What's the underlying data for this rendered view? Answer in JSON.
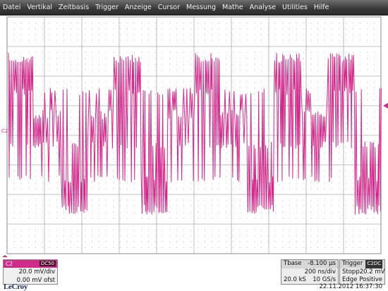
{
  "menubar": {
    "items": [
      "Datei",
      "Vertikal",
      "Zeitbasis",
      "Trigger",
      "Anzeige",
      "Cursor",
      "Messung",
      "Mathe",
      "Analyse",
      "Utilities",
      "Hilfe"
    ]
  },
  "channel_marker": "C2",
  "channel_panel": {
    "name": "C2",
    "coupling": "DC50",
    "vdiv": "20.0 mV/div",
    "offset": "0.00 mV ofst"
  },
  "timebase_panel": {
    "label": "Tbase",
    "delay": "-8.100 µs",
    "tdiv": "200 ns/div",
    "samples": "20.0 kS",
    "rate": "10 GS/s"
  },
  "trigger_panel": {
    "label": "Trigger",
    "source": "C2DC",
    "mode": "Stopp",
    "level": "20.2 mV",
    "type": "Edge",
    "slope": "Positive"
  },
  "logo": "LeCroy",
  "timestamp": "22.11.2012 16:37:30",
  "colors": {
    "trace": "#d02a8a",
    "grid": "#aaaaaa",
    "menubar": "#3c3c3c"
  },
  "trace_levels": [
    "high",
    "mid",
    "low",
    "mid",
    "high",
    "low",
    "mid",
    "high",
    "mid",
    "low",
    "high",
    "mid",
    "high",
    "low"
  ]
}
